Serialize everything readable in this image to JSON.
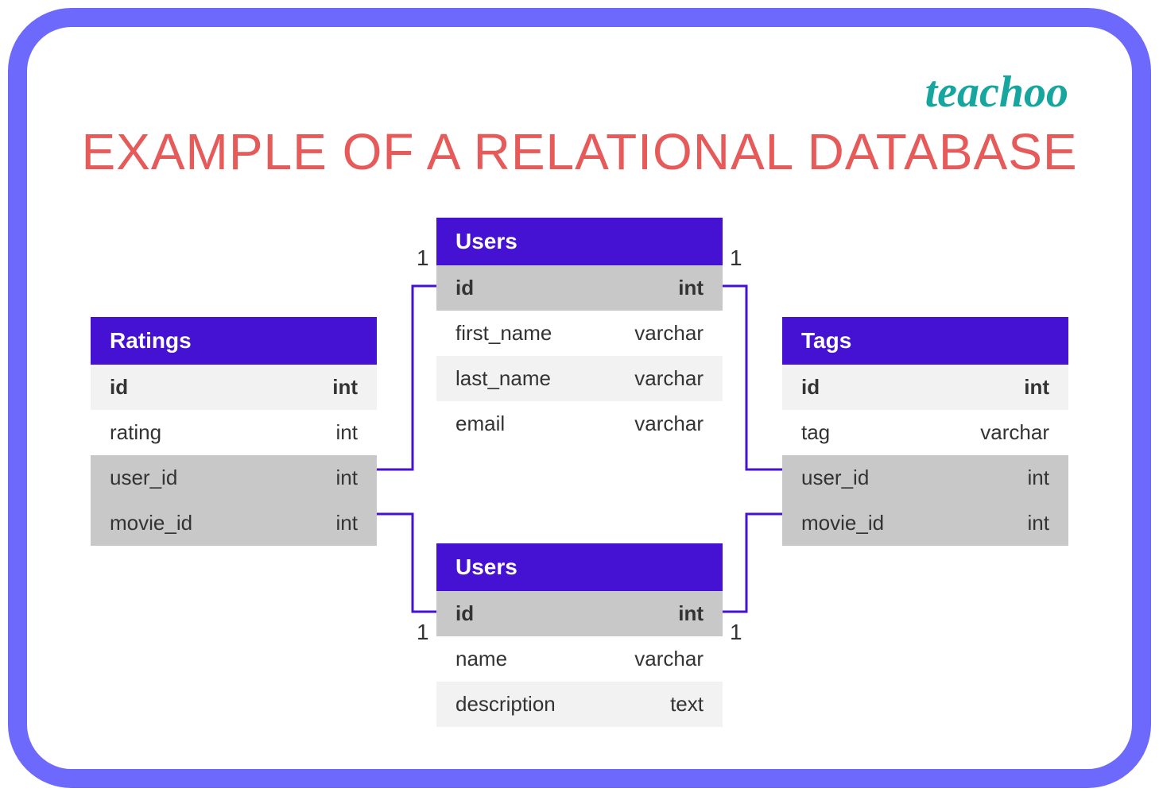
{
  "brand": "teachoo",
  "title": "EXAMPLE OF A RELATIONAL DATABASE",
  "tables": {
    "ratings": {
      "name": "Ratings",
      "rows": [
        {
          "name": "id",
          "type": "int",
          "style": "alt1",
          "bold": true
        },
        {
          "name": "rating",
          "type": "int",
          "style": "alt2",
          "bold": false
        },
        {
          "name": "user_id",
          "type": "int",
          "style": "fk",
          "bold": false
        },
        {
          "name": "movie_id",
          "type": "int",
          "style": "fk",
          "bold": false
        }
      ]
    },
    "users1": {
      "name": "Users",
      "rows": [
        {
          "name": "id",
          "type": "int",
          "style": "pk",
          "bold": true
        },
        {
          "name": "first_name",
          "type": "varchar",
          "style": "alt2",
          "bold": false
        },
        {
          "name": "last_name",
          "type": "varchar",
          "style": "alt1",
          "bold": false
        },
        {
          "name": "email",
          "type": "varchar",
          "style": "alt2",
          "bold": false
        }
      ]
    },
    "users2": {
      "name": "Users",
      "rows": [
        {
          "name": "id",
          "type": "int",
          "style": "pk",
          "bold": true
        },
        {
          "name": "name",
          "type": "varchar",
          "style": "alt2",
          "bold": false
        },
        {
          "name": "description",
          "type": "text",
          "style": "alt1",
          "bold": false
        }
      ]
    },
    "tags": {
      "name": "Tags",
      "rows": [
        {
          "name": "id",
          "type": "int",
          "style": "alt1",
          "bold": true
        },
        {
          "name": "tag",
          "type": "varchar",
          "style": "alt2",
          "bold": false
        },
        {
          "name": "user_id",
          "type": "int",
          "style": "fk",
          "bold": false
        },
        {
          "name": "movie_id",
          "type": "int",
          "style": "fk",
          "bold": false
        }
      ]
    }
  },
  "labels": {
    "one": "1"
  },
  "colors": {
    "frame": "#6d69fc",
    "header": "#4512d4",
    "title": "#e65a5a",
    "brand": "#16a69f",
    "row_light": "#f2f2f2",
    "row_key": "#c8c8c8"
  }
}
